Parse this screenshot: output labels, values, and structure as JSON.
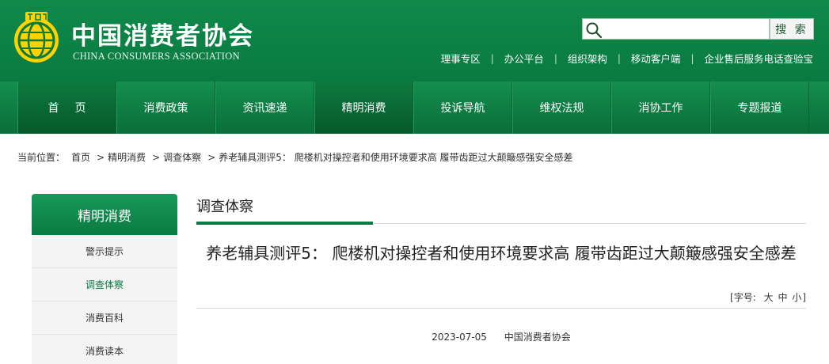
{
  "header": {
    "brand_cn": "中国消费者协会",
    "brand_en": "CHINA CONSUMERS ASSOCIATION",
    "logo_icon": "cca-emblem-icon",
    "colors": {
      "primary": "#0a7a40",
      "accent": "#ffd200"
    }
  },
  "search": {
    "placeholder": "",
    "value": "",
    "button_label": "搜 索"
  },
  "top_links": [
    {
      "label": "理事专区"
    },
    {
      "label": "办公平台"
    },
    {
      "label": "组织架构"
    },
    {
      "label": "移动客户端"
    },
    {
      "label": "企业售后服务电话查验宝"
    }
  ],
  "nav": {
    "items": [
      {
        "label": "首页"
      },
      {
        "label": "消费政策"
      },
      {
        "label": "资讯速递"
      },
      {
        "label": "精明消费"
      },
      {
        "label": "投诉导航"
      },
      {
        "label": "维权法规"
      },
      {
        "label": "消协工作"
      },
      {
        "label": "专题报道"
      }
    ],
    "active": "精明消费"
  },
  "breadcrumb": {
    "prefix": "当前位置：",
    "items": [
      "首页",
      "精明消费",
      "调查体察",
      "养老辅具测评5：  爬楼机对操控者和使用环境要求高 履带齿距过大颠簸感强安全感差"
    ]
  },
  "sidebar": {
    "title": "精明消费",
    "items": [
      {
        "label": "警示提示"
      },
      {
        "label": "调查体察"
      },
      {
        "label": "消费百科"
      },
      {
        "label": "消费读本"
      }
    ],
    "active": "调查体察"
  },
  "main": {
    "section_title": "调查体察",
    "article_title": "养老辅具测评5：  爬楼机对操控者和使用环境要求高 履带齿距过大颠簸感强安全感差",
    "font_size": {
      "prefix": "[字号:",
      "large": "大",
      "medium": "中",
      "small": "小",
      "suffix": "]"
    },
    "date": "2023-07-05",
    "publisher": "中国消费者协会"
  }
}
